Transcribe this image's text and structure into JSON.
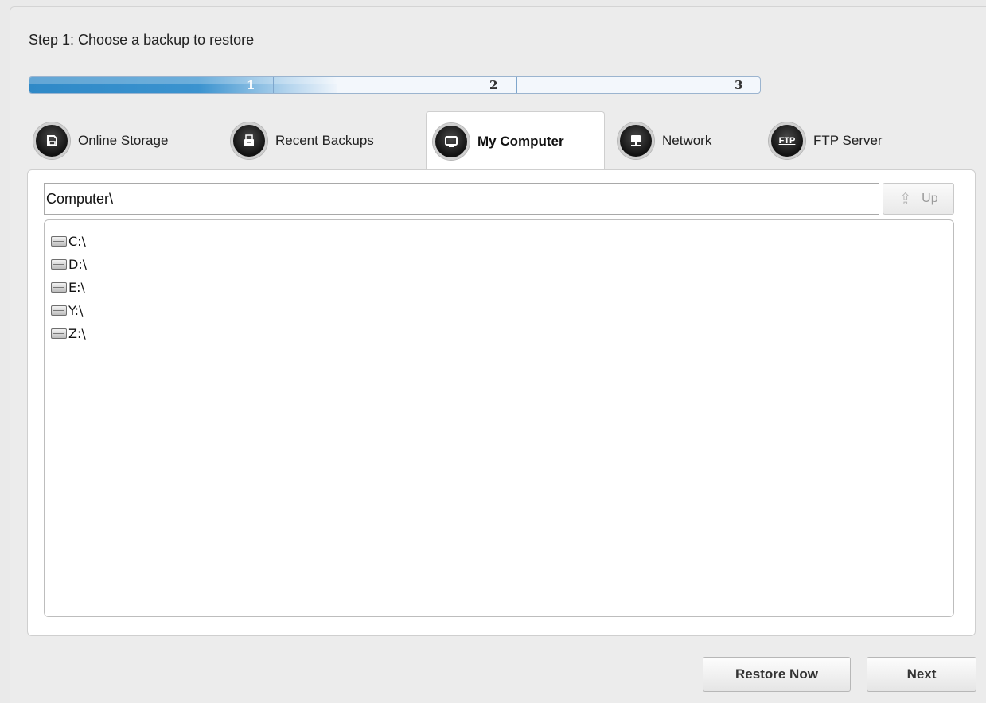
{
  "step_title": "Step 1: Choose a backup to restore",
  "progress": {
    "steps": [
      "1",
      "2",
      "3"
    ],
    "current_step": 1,
    "fill_fraction": 0.42
  },
  "tabs": [
    {
      "label": "Online Storage",
      "icon": "storage-icon"
    },
    {
      "label": "Recent Backups",
      "icon": "backups-icon"
    },
    {
      "label": "My Computer",
      "icon": "computer-icon",
      "active": true
    },
    {
      "label": "Network",
      "icon": "network-icon"
    },
    {
      "label": "FTP Server",
      "icon": "ftp-icon",
      "icon_text": "FTP"
    }
  ],
  "path": {
    "value": "Computer\\"
  },
  "up_button": {
    "label": "Up"
  },
  "drives": [
    "C:\\",
    "D:\\",
    "E:\\",
    "Y:\\",
    "Z:\\"
  ],
  "buttons": {
    "restore_now": "Restore Now",
    "next": "Next"
  },
  "colors": {
    "progress": "#2f89c7",
    "panel": "#ffffff",
    "background": "#eaeaea"
  }
}
